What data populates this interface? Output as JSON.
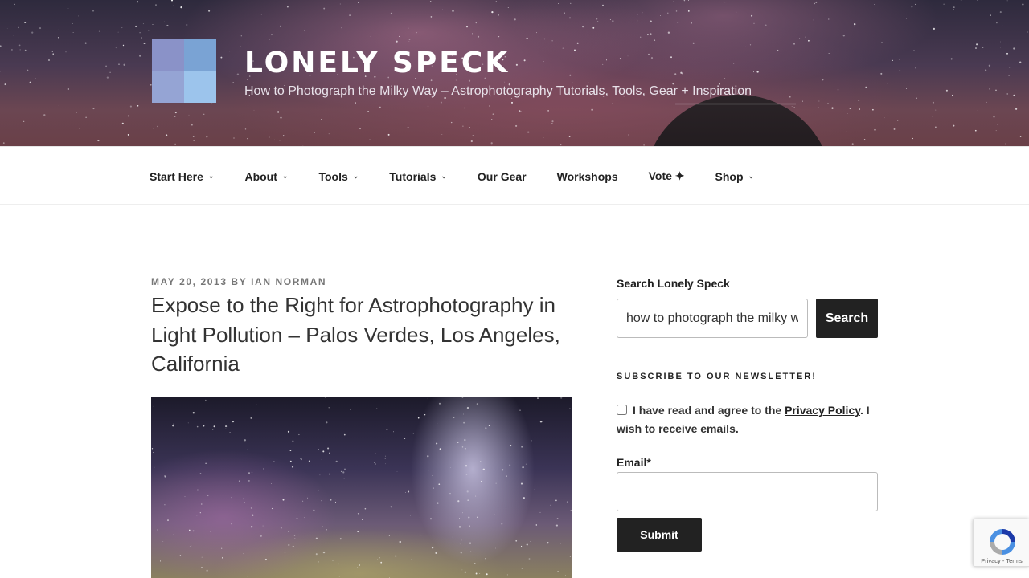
{
  "header": {
    "title": "LONELY SPECK",
    "description": "How to Photograph the Milky Way – Astrophotography Tutorials, Tools, Gear + Inspiration"
  },
  "nav": {
    "items": [
      {
        "label": "Start Here",
        "dropdown": true
      },
      {
        "label": "About",
        "dropdown": true
      },
      {
        "label": "Tools",
        "dropdown": true
      },
      {
        "label": "Tutorials",
        "dropdown": true
      },
      {
        "label": "Our Gear",
        "dropdown": false
      },
      {
        "label": "Workshops",
        "dropdown": false
      },
      {
        "label": "Vote ✦",
        "dropdown": false
      },
      {
        "label": "Shop",
        "dropdown": true
      }
    ]
  },
  "post": {
    "date": "MAY 20, 2013",
    "by": "BY",
    "author": "IAN NORMAN",
    "title": "Expose to the Right for Astrophotography in Light Pollution – Palos Verdes, Los Angeles, California"
  },
  "sidebar": {
    "search_label": "Search Lonely Speck",
    "search_value": "how to photograph the milky way",
    "search_button": "Search",
    "newsletter_heading": "SUBSCRIBE TO OUR NEWSLETTER!",
    "consent_prefix": "I have read and agree to the ",
    "consent_link": "Privacy Policy",
    "consent_suffix": ". I wish to receive emails.",
    "email_label": "Email*",
    "submit_label": "Submit"
  },
  "recaptcha": {
    "text": "Privacy - Terms"
  },
  "colors": {
    "header_bg": "#4a3a52",
    "text": "#333333",
    "button": "#222222",
    "meta": "#767676"
  }
}
